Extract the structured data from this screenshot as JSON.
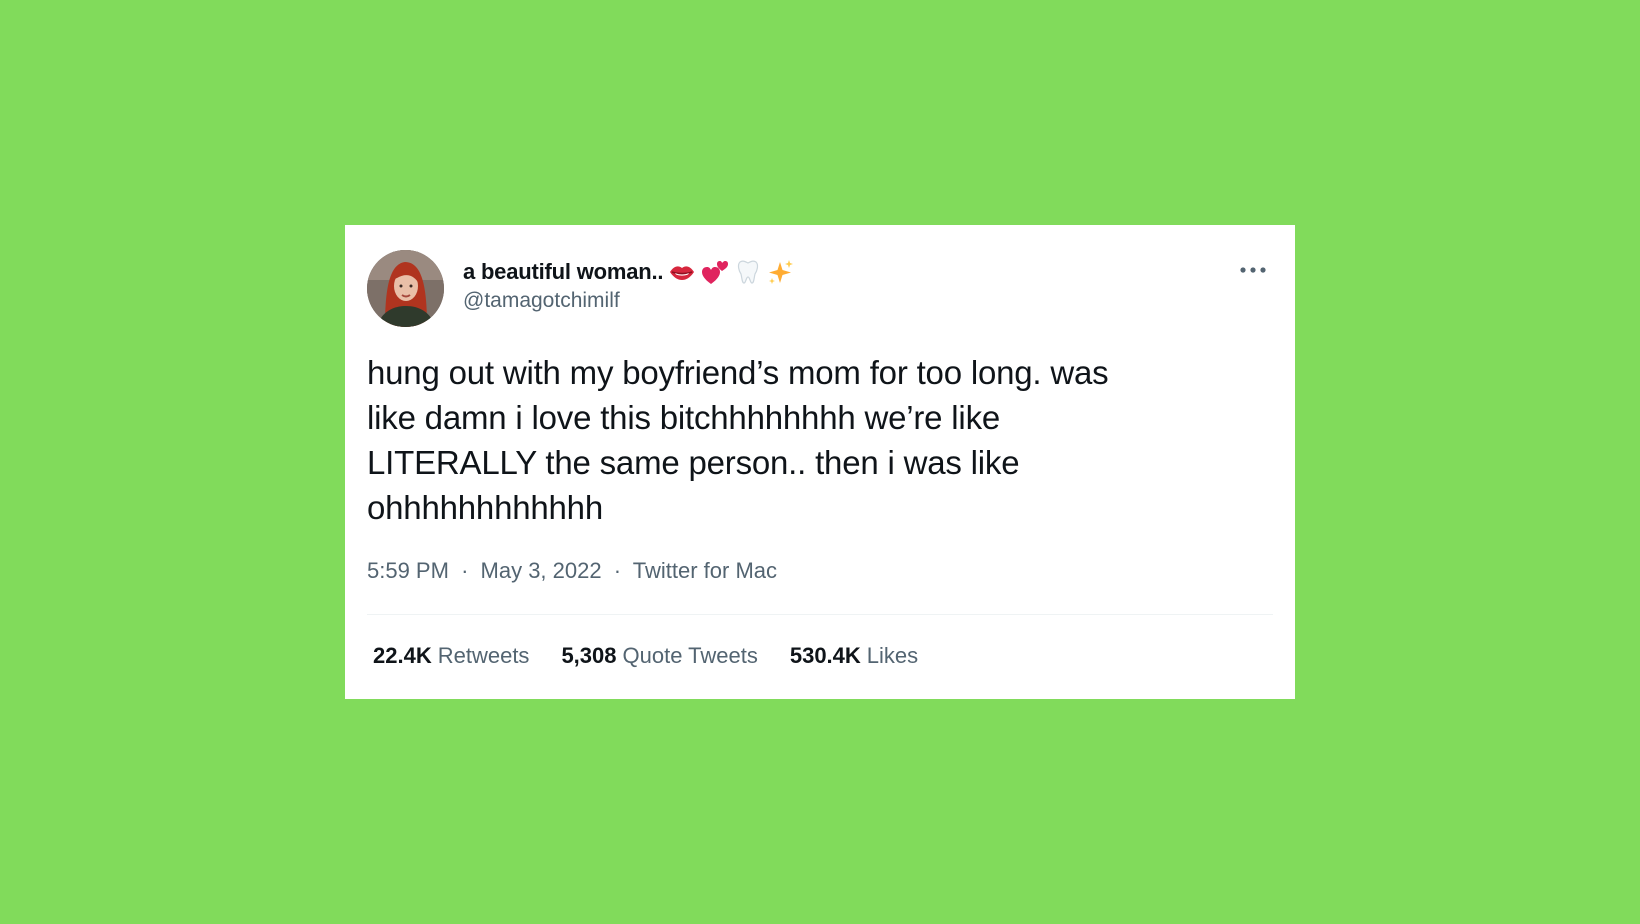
{
  "colors": {
    "background": "#81db5b",
    "card": "#ffffff",
    "primary_text": "#0f1419",
    "secondary_text": "#536471",
    "divider": "#eff3f4"
  },
  "author": {
    "display_name": "a beautiful woman..",
    "display_name_emojis": [
      "lips-icon",
      "two-hearts-icon",
      "tooth-icon",
      "sparkles-icon"
    ],
    "handle": "@tamagotchimilf",
    "avatar": "profile-photo"
  },
  "tweet": {
    "text": "hung out with my boyfriend’s mom for too long. was\nlike damn i love this bitchhhhhhhh we’re like\nLITERALLY the same person.. then i was like\nohhhhhhhhhhhh",
    "time": "5:59 PM",
    "separator": "·",
    "date": "May 3, 2022",
    "source": "Twitter for Mac"
  },
  "stats": {
    "retweets": {
      "count": "22.4K",
      "label": "Retweets"
    },
    "quotes": {
      "count": "5,308",
      "label": "Quote Tweets"
    },
    "likes": {
      "count": "530.4K",
      "label": "Likes"
    }
  },
  "menu": {
    "icon": "more-horizontal-icon"
  }
}
